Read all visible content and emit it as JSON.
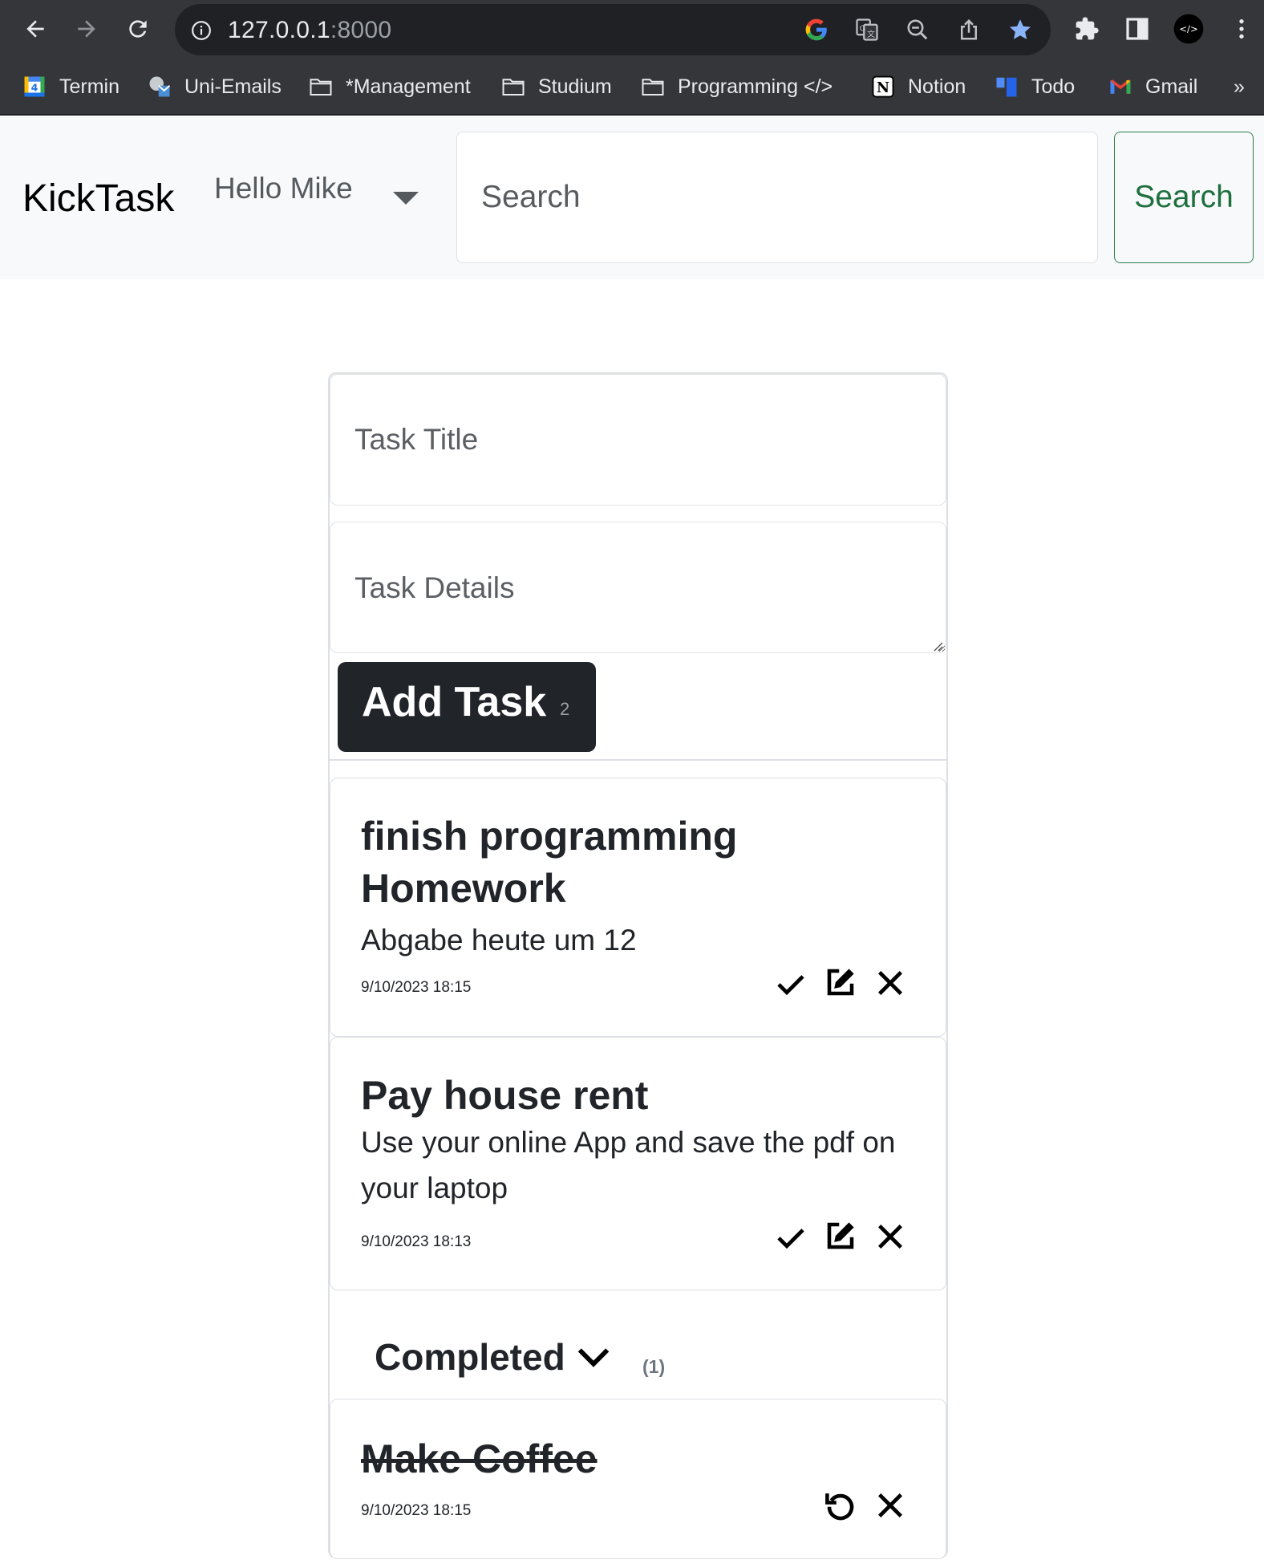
{
  "browser": {
    "url_host": "127.0.0.1",
    "url_port": ":8000",
    "bookmarks": [
      {
        "label": "Termin",
        "icon": "calendar-icon"
      },
      {
        "label": "Uni-Emails",
        "icon": "uni-emails-icon"
      },
      {
        "label": "*Management",
        "icon": "folder-icon"
      },
      {
        "label": "Studium",
        "icon": "folder-icon"
      },
      {
        "label": "Programming </>",
        "icon": "folder-icon"
      },
      {
        "label": "Notion",
        "icon": "notion-icon"
      },
      {
        "label": "Todo",
        "icon": "todo-icon"
      },
      {
        "label": "Gmail",
        "icon": "gmail-icon"
      }
    ],
    "bookmarks_overflow": "»",
    "calendar_day": "4"
  },
  "navbar": {
    "brand": "KickTask",
    "greeting": "Hello Mike",
    "search_placeholder": "Search",
    "search_button": "Search"
  },
  "form": {
    "title_placeholder": "Task Title",
    "details_placeholder": "Task Details",
    "add_label": "Add Task",
    "add_count": "2"
  },
  "tasks": [
    {
      "title_line1": "finish programming",
      "title_line2": "Homework",
      "details": "Abgabe heute um 12",
      "timestamp": "9/10/2023 18:15"
    },
    {
      "title": "Pay house rent",
      "details_line1": "Use your online App and save the pdf on",
      "details_line2": "your laptop",
      "timestamp": "9/10/2023 18:13"
    }
  ],
  "completed": {
    "label": "Completed",
    "count": "(1)",
    "tasks": [
      {
        "title": "Make Coffee",
        "timestamp": "9/10/2023 18:15"
      }
    ]
  },
  "colors": {
    "chrome_bg": "#35363a",
    "omnibox_bg": "#202124",
    "navbar_bg": "#f8f9fa",
    "search_btn_border": "#2e7d4a",
    "add_btn_bg": "#212529",
    "star_blue": "#8ab4f8"
  }
}
